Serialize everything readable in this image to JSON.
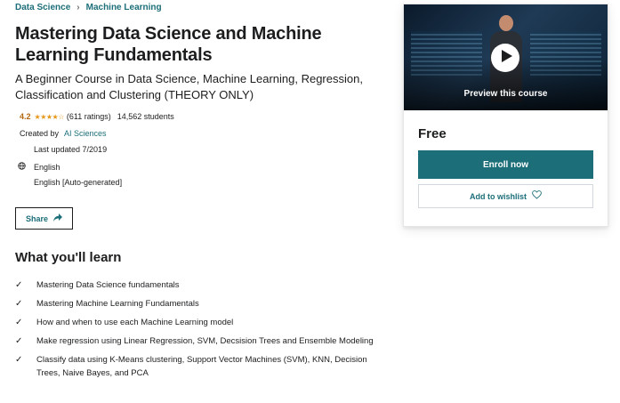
{
  "breadcrumb": {
    "items": [
      "Data Science",
      "Machine Learning"
    ],
    "separator": "›"
  },
  "course": {
    "title": "Mastering Data Science and Machine Learning Fundamentals",
    "subtitle": "A Beginner Course in Data Science, Machine Learning, Regression, Classification and Clustering (THEORY ONLY)",
    "rating": "4.2",
    "stars": "★★★★☆",
    "rating_fraction": 0.84,
    "ratings_count": "(611 ratings)",
    "students": "14,562 students",
    "created_by_label": "Created by",
    "author": "AI Sciences",
    "last_updated": "Last updated 7/2019",
    "language": "English",
    "captions": "English [Auto-generated]"
  },
  "share": {
    "label": "Share",
    "icon": "share-arrow-icon"
  },
  "learn": {
    "title": "What you'll learn",
    "items": [
      "Mastering Data Science fundamentals",
      "Mastering Machine Learning Fundamentals",
      "How and when to use each Machine Learning model",
      "Make regression using Linear Regression, SVM, Decsision Trees and Ensemble Modeling",
      "Classify data using K-Means clustering, Support Vector Machines (SVM), KNN, Decision Trees, Naive Bayes, and PCA"
    ]
  },
  "card": {
    "preview_label": "Preview this course",
    "price": "Free",
    "enroll_label": "Enroll now",
    "wishlist_label": "Add to wishlist"
  },
  "colors": {
    "brand": "#1c6e79",
    "rating": "#b4690e",
    "star": "#e59819"
  }
}
